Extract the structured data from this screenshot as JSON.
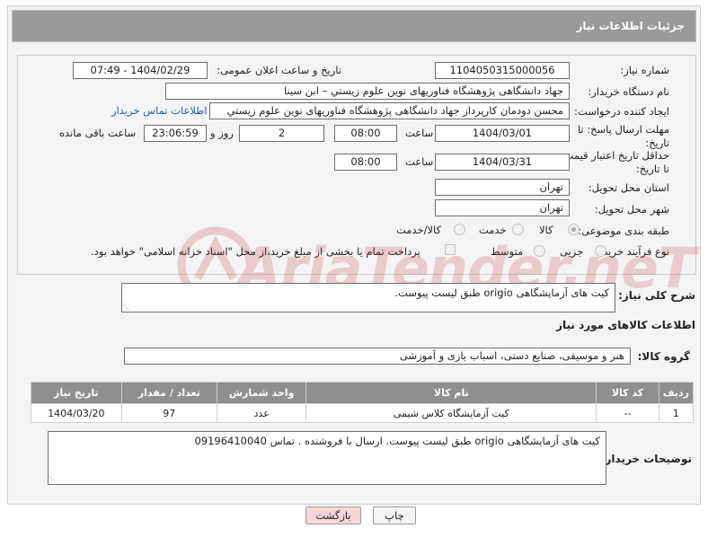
{
  "header": {
    "title": "جزئیات اطلاعات نیاز"
  },
  "form": {
    "need_number_label": "شماره نیاز:",
    "need_number": "1104050315000056",
    "announce_label": "تاریخ و ساعت اعلان عمومی:",
    "announce_value": "1404/02/29 - 07:49",
    "buyer_org_label": "نام دستگاه خریدار:",
    "buyer_org": "جهاد دانشگاهی پژوهشگاه فناوریهای نوین علوم زیستي – ابن سینا",
    "creator_label": "ایجاد کننده درخواست:",
    "creator": "محسن دودمان کارپرداز جهاد دانشگاهی پژوهشگاه فناوریهای نوین علوم زیستي",
    "contact_link": "اطلاعات تماس خریدار",
    "deadline_label": "مهلت ارسال پاسخ: تا تاریخ:",
    "deadline_date": "1404/03/01",
    "time_label": "ساعت",
    "deadline_time": "08:00",
    "days_value": "2",
    "days_label": "روز و",
    "remaining_time": "23:06:59",
    "remaining_label": "ساعت باقی مانده",
    "validity_label": "حداقل تاریخ اعتبار قیمت: تا تاریخ:",
    "validity_date": "1404/03/31",
    "validity_time": "08:00",
    "province_label": "استان محل تحویل:",
    "province": "تهران",
    "city_label": "شهر محل تحویل:",
    "city": "تهران",
    "category_label": "طبقه بندی موضوعی:",
    "category_options": [
      "کالا",
      "خدمت",
      "کالا/خدمت"
    ],
    "process_label": "نوع فرآیند خرید :",
    "process_options": [
      "جزیی",
      "متوسط"
    ],
    "payment_note": "پرداخت تمام یا بخشی از مبلغ خرید،از محل \"اسناد خزانه اسلامی\" خواهد بود."
  },
  "description": {
    "label": "شرح کلی نیاز:",
    "text": "کیت های آزمایشگاهی origio طبق لیست پیوست."
  },
  "goods": {
    "section_title": "اطلاعات کالاهای مورد نیاز",
    "group_label": "گروه کالا:",
    "group_value": "هنر و موسیقی، صنایع دستی، اسباب بازی و آموزشی",
    "columns": [
      "ردیف",
      "کد کالا",
      "نام کالا",
      "واحد شمارش",
      "تعداد / مقدار",
      "تاریخ نیاز"
    ],
    "rows": [
      [
        "1",
        "--",
        "کیت آزمایشگاه کلاس شیمی",
        "عدد",
        "97",
        "1404/03/20"
      ]
    ]
  },
  "buyer_notes": {
    "label": "توضیحات خریدار:",
    "text": "کیت های آزمایشگاهی origio طبق لیست پیوست. ارسال با فروشنده . تماس 09196410040"
  },
  "buttons": {
    "print": "چاپ",
    "back": "بازگشت"
  },
  "watermark": {
    "text": "AriaTender.neT"
  },
  "colors": {
    "header_bg": "#9a9a9a",
    "table_header_bg": "#8f8f8f",
    "link": "#1a5fb4",
    "back_btn_bg": "#f7d6d6"
  }
}
